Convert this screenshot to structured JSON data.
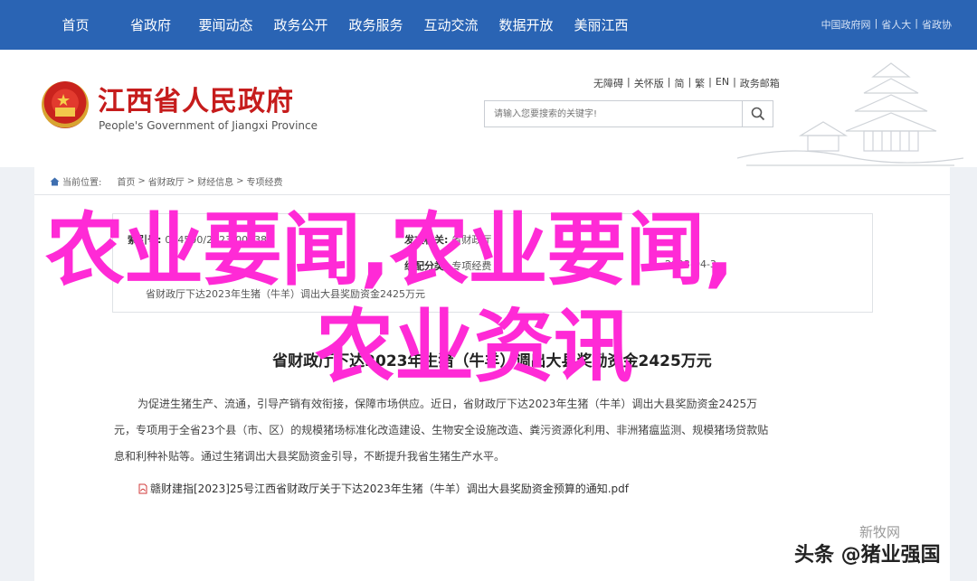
{
  "topnav": {
    "items": [
      "首页",
      "省政府",
      "要闻动态",
      "政务公开",
      "政务服务",
      "互动交流",
      "数据开放",
      "美丽江西"
    ],
    "right_links": [
      "中国政府网",
      "|",
      "省人大",
      "|",
      "省政协"
    ]
  },
  "header": {
    "site_name_cn": "江西省人民政府",
    "site_name_en": "People's Government of Jiangxi Province",
    "tool_links": [
      "无障碍",
      "|",
      "关怀版",
      "|",
      "简",
      "|",
      "繁",
      "|",
      "EN",
      "|",
      "政务邮箱"
    ],
    "search_placeholder": "请输入您要搜索的关键字!"
  },
  "breadcrumb": {
    "current_position_label": "当前位置:",
    "items": [
      "首页",
      ">",
      "省财政厅",
      ">",
      "财经信息",
      ">",
      "专项经费"
    ]
  },
  "infobox": {
    "index_label": "索引号:",
    "index_value": "014500/2023-00338",
    "publisher_label": "发文机关:",
    "publisher_value": "省财政厅",
    "category_label": "组配分类:",
    "category_value": "专项经费",
    "date_value": "2023-04-3",
    "title_value": "省财政厅下达2023年生猪（牛羊）调出大县奖励资金2425万元"
  },
  "article": {
    "title": "省财政厅下达2023年生猪（牛羊）调出大县奖励资金2425万元",
    "paragraph_lines": [
      "为促进生猪生产、流通，引导产销有效衔接，保障市场供应。近日，省财政厅下达2023年生猪（牛羊）调出大县奖励资金2425万",
      "元，专项用于全省23个县（市、区）的规模猪场标准化改造建设、生物安全设施改造、粪污资源化利用、非洲猪瘟监测、规模猪场贷款贴",
      "息和利种补贴等。通过生猪调出大县奖励资金引导，不断提升我省生猪生产水平。"
    ],
    "attachment": "赣财建指[2023]25号江西省财政厅关于下达2023年生猪（牛羊）调出大县奖励资金预算的通知.pdf"
  },
  "overlay": {
    "line1": "农业要闻,农业要闻,",
    "line2": "农业资讯"
  },
  "watermark": {
    "line1": "新牧网",
    "line2": "头条 @猪业强国"
  },
  "colors": {
    "nav_bg": "#2a64b4",
    "site_name_red": "#c61c1c",
    "overlay_magenta": "#ff2ad6"
  }
}
